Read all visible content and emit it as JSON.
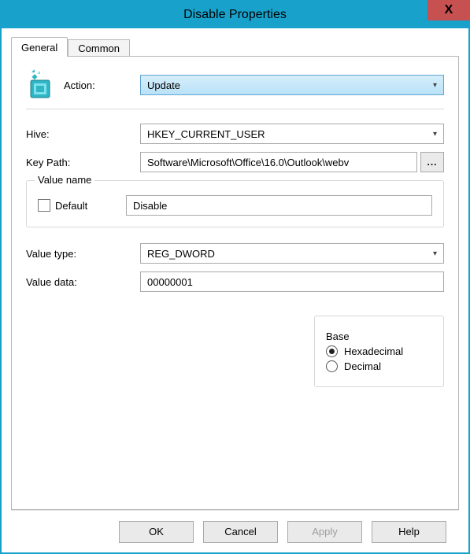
{
  "title": "Disable Properties",
  "tabs": {
    "general": "General",
    "common": "Common"
  },
  "labels": {
    "action": "Action:",
    "hive": "Hive:",
    "keypath": "Key Path:",
    "valuename_legend": "Value name",
    "default": "Default",
    "valuetype": "Value type:",
    "valuedata": "Value data:",
    "base_legend": "Base",
    "hex": "Hexadecimal",
    "dec": "Decimal"
  },
  "values": {
    "action": "Update",
    "hive": "HKEY_CURRENT_USER",
    "keypath": "Software\\Microsoft\\Office\\16.0\\Outlook\\webv",
    "valuename": "Disable",
    "valuetype": "REG_DWORD",
    "valuedata": "00000001"
  },
  "buttons": {
    "browse": "...",
    "ok": "OK",
    "cancel": "Cancel",
    "apply": "Apply",
    "help": "Help"
  }
}
